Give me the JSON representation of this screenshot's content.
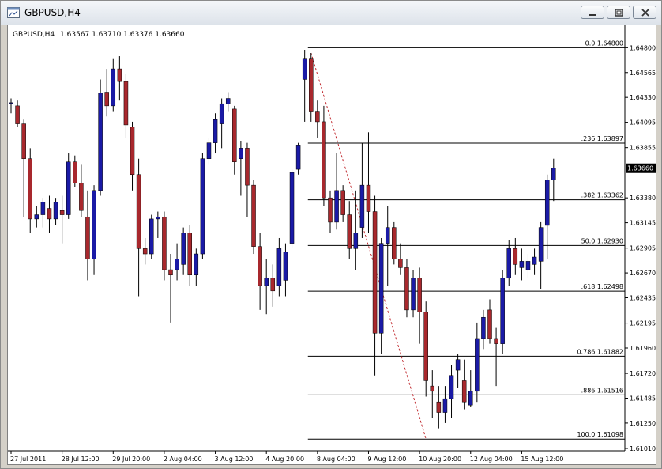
{
  "window": {
    "title": "GBPUSD,H4"
  },
  "chart_data": {
    "type": "candlestick",
    "symbol": "GBPUSD,H4",
    "ohlc_label": "1.63567 1.63710 1.63376 1.63660",
    "current_price": 1.6366,
    "current_price_label": "1.63660",
    "ylim": [
      1.6101,
      1.6484
    ],
    "y_ticks": [
      {
        "label": "1.64800",
        "value": 1.648
      },
      {
        "label": "1.64565",
        "value": 1.64565
      },
      {
        "label": "1.64330",
        "value": 1.6433
      },
      {
        "label": "1.64095",
        "value": 1.64095
      },
      {
        "label": "1.63855",
        "value": 1.63855
      },
      {
        "label": "1.63380",
        "value": 1.6338
      },
      {
        "label": "1.63145",
        "value": 1.63145
      },
      {
        "label": "1.62905",
        "value": 1.62905
      },
      {
        "label": "1.62670",
        "value": 1.6267
      },
      {
        "label": "1.62435",
        "value": 1.62435
      },
      {
        "label": "1.62195",
        "value": 1.62195
      },
      {
        "label": "1.61960",
        "value": 1.6196
      },
      {
        "label": "1.61720",
        "value": 1.6172
      },
      {
        "label": "1.61485",
        "value": 1.61485
      },
      {
        "label": "1.61250",
        "value": 1.6125
      },
      {
        "label": "1.61010",
        "value": 1.6101
      }
    ],
    "x_labels": [
      {
        "label": "27 Jul 2011",
        "index": 0
      },
      {
        "label": "28 Jul 12:00",
        "index": 8
      },
      {
        "label": "29 Jul 20:00",
        "index": 16
      },
      {
        "label": "2 Aug 04:00",
        "index": 24
      },
      {
        "label": "3 Aug 12:00",
        "index": 32
      },
      {
        "label": "4 Aug 20:00",
        "index": 40
      },
      {
        "label": "8 Aug 04:00",
        "index": 48
      },
      {
        "label": "9 Aug 12:00",
        "index": 56
      },
      {
        "label": "10 Aug 20:00",
        "index": 64
      },
      {
        "label": "12 Aug 04:00",
        "index": 72
      },
      {
        "label": "15 Aug 12:00",
        "index": 80
      }
    ],
    "fibonacci": {
      "levels": [
        {
          "ratio_label": "0.0",
          "price_label": "1.64800",
          "price": 1.648
        },
        {
          "ratio_label": ".236",
          "price_label": "1.63897",
          "price": 1.63897
        },
        {
          "ratio_label": ".382",
          "price_label": "1.63362",
          "price": 1.63362
        },
        {
          "ratio_label": "50.0",
          "price_label": "1.62930",
          "price": 1.6293
        },
        {
          "ratio_label": ".618",
          "price_label": "1.62498",
          "price": 1.62498
        },
        {
          "ratio_label": "0.786",
          "price_label": "1.61882",
          "price": 1.61882
        },
        {
          "ratio_label": ".886",
          "price_label": "1.61516",
          "price": 1.61516
        },
        {
          "ratio_label": "100.0",
          "price_label": "1.61098",
          "price": 1.61098
        }
      ],
      "anchor_start_index": 47,
      "anchor_end_index": 65,
      "trend_high": 1.6475,
      "trend_low": 1.611
    },
    "candles": [
      [
        1.6428,
        1.6432,
        1.6418,
        1.6428
      ],
      [
        1.6425,
        1.643,
        1.6405,
        1.6408
      ],
      [
        1.6408,
        1.6412,
        1.632,
        1.6375
      ],
      [
        1.6375,
        1.6385,
        1.6305,
        1.6318
      ],
      [
        1.6318,
        1.633,
        1.631,
        1.6322
      ],
      [
        1.6322,
        1.6338,
        1.631,
        1.6334
      ],
      [
        1.6328,
        1.634,
        1.6305,
        1.6318
      ],
      [
        1.6318,
        1.6338,
        1.6312,
        1.6334
      ],
      [
        1.6326,
        1.634,
        1.6295,
        1.6322
      ],
      [
        1.6322,
        1.638,
        1.6318,
        1.6372
      ],
      [
        1.6372,
        1.6378,
        1.6348,
        1.6352
      ],
      [
        1.6352,
        1.637,
        1.632,
        1.6326
      ],
      [
        1.632,
        1.6345,
        1.626,
        1.628
      ],
      [
        1.628,
        1.635,
        1.6265,
        1.6345
      ],
      [
        1.6345,
        1.645,
        1.634,
        1.6437
      ],
      [
        1.6438,
        1.646,
        1.6415,
        1.6425
      ],
      [
        1.6425,
        1.647,
        1.642,
        1.646
      ],
      [
        1.646,
        1.6472,
        1.643,
        1.6448
      ],
      [
        1.6448,
        1.6455,
        1.6395,
        1.6407
      ],
      [
        1.6405,
        1.641,
        1.6345,
        1.636
      ],
      [
        1.636,
        1.6375,
        1.6245,
        1.629
      ],
      [
        1.629,
        1.63,
        1.6275,
        1.6285
      ],
      [
        1.6285,
        1.6322,
        1.628,
        1.6318
      ],
      [
        1.6318,
        1.6325,
        1.63,
        1.632
      ],
      [
        1.632,
        1.6325,
        1.626,
        1.627
      ],
      [
        1.627,
        1.6285,
        1.622,
        1.6265
      ],
      [
        1.627,
        1.6295,
        1.626,
        1.628
      ],
      [
        1.6275,
        1.631,
        1.6265,
        1.6305
      ],
      [
        1.6305,
        1.6312,
        1.6255,
        1.6265
      ],
      [
        1.6265,
        1.629,
        1.6255,
        1.6285
      ],
      [
        1.6285,
        1.638,
        1.628,
        1.6375
      ],
      [
        1.6375,
        1.6395,
        1.637,
        1.639
      ],
      [
        1.639,
        1.6418,
        1.638,
        1.6412
      ],
      [
        1.6408,
        1.6432,
        1.6385,
        1.6427
      ],
      [
        1.6427,
        1.6438,
        1.642,
        1.6432
      ],
      [
        1.6422,
        1.6425,
        1.636,
        1.6372
      ],
      [
        1.6375,
        1.6392,
        1.634,
        1.6385
      ],
      [
        1.6385,
        1.639,
        1.632,
        1.635
      ],
      [
        1.635,
        1.6355,
        1.6285,
        1.6292
      ],
      [
        1.6292,
        1.6305,
        1.6232,
        1.6255
      ],
      [
        1.6255,
        1.628,
        1.6228,
        1.6262
      ],
      [
        1.6262,
        1.6275,
        1.6235,
        1.625
      ],
      [
        1.6255,
        1.63,
        1.6245,
        1.629
      ],
      [
        1.626,
        1.6295,
        1.6245,
        1.6287
      ],
      [
        1.6295,
        1.6365,
        1.629,
        1.6362
      ],
      [
        1.6365,
        1.639,
        1.636,
        1.6388
      ],
      [
        1.645,
        1.6478,
        1.641,
        1.647
      ],
      [
        1.647,
        1.6475,
        1.641,
        1.642
      ],
      [
        1.642,
        1.643,
        1.6395,
        1.641
      ],
      [
        1.641,
        1.6425,
        1.633,
        1.6338
      ],
      [
        1.6338,
        1.6345,
        1.6305,
        1.6315
      ],
      [
        1.6315,
        1.638,
        1.6308,
        1.6345
      ],
      [
        1.6345,
        1.635,
        1.6315,
        1.6322
      ],
      [
        1.6322,
        1.6335,
        1.628,
        1.629
      ],
      [
        1.629,
        1.6345,
        1.627,
        1.6305
      ],
      [
        1.631,
        1.639,
        1.63,
        1.635
      ],
      [
        1.635,
        1.64,
        1.6305,
        1.6325
      ],
      [
        1.6325,
        1.634,
        1.617,
        1.621
      ],
      [
        1.621,
        1.63,
        1.619,
        1.6295
      ],
      [
        1.6295,
        1.633,
        1.6255,
        1.631
      ],
      [
        1.631,
        1.6315,
        1.6275,
        1.628
      ],
      [
        1.628,
        1.6295,
        1.6265,
        1.6272
      ],
      [
        1.6272,
        1.628,
        1.6225,
        1.6232
      ],
      [
        1.6232,
        1.627,
        1.6225,
        1.6262
      ],
      [
        1.6262,
        1.6272,
        1.62,
        1.623
      ],
      [
        1.623,
        1.624,
        1.615,
        1.6165
      ],
      [
        1.616,
        1.6175,
        1.613,
        1.6155
      ],
      [
        1.6145,
        1.616,
        1.612,
        1.6135
      ],
      [
        1.6135,
        1.616,
        1.6125,
        1.6148
      ],
      [
        1.6148,
        1.618,
        1.613,
        1.617
      ],
      [
        1.6175,
        1.619,
        1.6158,
        1.6185
      ],
      [
        1.6165,
        1.6185,
        1.6138,
        1.6145
      ],
      [
        1.6142,
        1.6175,
        1.614,
        1.6155
      ],
      [
        1.6155,
        1.622,
        1.6145,
        1.6205
      ],
      [
        1.6205,
        1.6232,
        1.6195,
        1.6225
      ],
      [
        1.6232,
        1.6242,
        1.62,
        1.6205
      ],
      [
        1.6205,
        1.6215,
        1.616,
        1.62
      ],
      [
        1.62,
        1.627,
        1.619,
        1.6262
      ],
      [
        1.6262,
        1.6298,
        1.6255,
        1.629
      ],
      [
        1.629,
        1.63,
        1.6265,
        1.6275
      ],
      [
        1.6272,
        1.629,
        1.626,
        1.6278
      ],
      [
        1.627,
        1.6285,
        1.6262,
        1.6278
      ],
      [
        1.6275,
        1.629,
        1.6265,
        1.6282
      ],
      [
        1.6278,
        1.6315,
        1.6252,
        1.631
      ],
      [
        1.6312,
        1.636,
        1.628,
        1.6355
      ],
      [
        1.6355,
        1.6375,
        1.6335,
        1.6366
      ]
    ]
  }
}
